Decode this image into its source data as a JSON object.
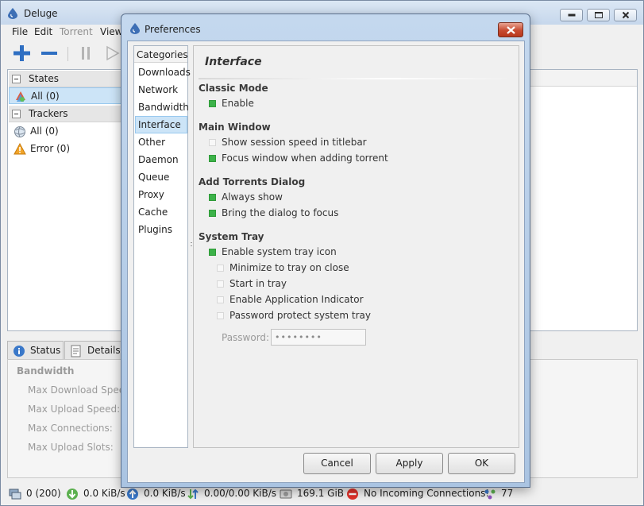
{
  "main": {
    "title": "Deluge",
    "menu": [
      "File",
      "Edit",
      "Torrent",
      "View"
    ],
    "toolbar": {
      "add": "add-torrent",
      "remove": "remove-torrent",
      "pause": "pause",
      "resume": "resume"
    },
    "sidebar": {
      "states_header": "States",
      "states": [
        {
          "label": "All (0)",
          "selected": true
        }
      ],
      "trackers_header": "Trackers",
      "trackers": [
        {
          "label": "All (0)"
        },
        {
          "label": "Error (0)"
        }
      ]
    },
    "details": {
      "tabs": [
        "Status",
        "Details"
      ],
      "section": "Bandwidth",
      "labels": [
        "Max Download Speed",
        "Max Upload Speed:",
        "Max Connections:",
        "Max Upload Slots:"
      ]
    },
    "statusbar": {
      "connections": "0 (200)",
      "download": "0.0 KiB/s",
      "upload": "0.0 KiB/s",
      "protocol": "0.00/0.00 KiB/s",
      "disk": "169.1 GiB",
      "incoming": "No Incoming Connections!",
      "dht": "77"
    }
  },
  "prefs": {
    "title": "Preferences",
    "categories_header": "Categories",
    "categories": [
      "Downloads",
      "Network",
      "Bandwidth",
      "Interface",
      "Other",
      "Daemon",
      "Queue",
      "Proxy",
      "Cache",
      "Plugins"
    ],
    "selected_category": "Interface",
    "pane_title": "Interface",
    "groups": {
      "classic_mode": "Classic Mode",
      "main_window": "Main Window",
      "add_torrents": "Add Torrents Dialog",
      "system_tray": "System Tray"
    },
    "options": {
      "enable": {
        "label": "Enable",
        "checked": true
      },
      "show_speed": {
        "label": "Show session speed in titlebar",
        "checked": false
      },
      "focus_window": {
        "label": "Focus window when adding torrent",
        "checked": true
      },
      "always_show": {
        "label": "Always show",
        "checked": true
      },
      "bring_focus": {
        "label": "Bring the dialog to focus",
        "checked": true
      },
      "tray_icon": {
        "label": "Enable system tray icon",
        "checked": true
      },
      "minimize_tray": {
        "label": "Minimize to tray on close",
        "checked": false
      },
      "start_tray": {
        "label": "Start in tray",
        "checked": false
      },
      "app_indicator": {
        "label": "Enable Application Indicator",
        "checked": false
      },
      "password_protect": {
        "label": "Password protect system tray",
        "checked": false
      }
    },
    "password_label": "Password:",
    "password_value": "••••••••",
    "buttons": {
      "cancel": "Cancel",
      "apply": "Apply",
      "ok": "OK"
    }
  },
  "colors": {
    "checked": "#3cb249",
    "selection": "#cce4f7",
    "close_button": "#c74b31"
  }
}
